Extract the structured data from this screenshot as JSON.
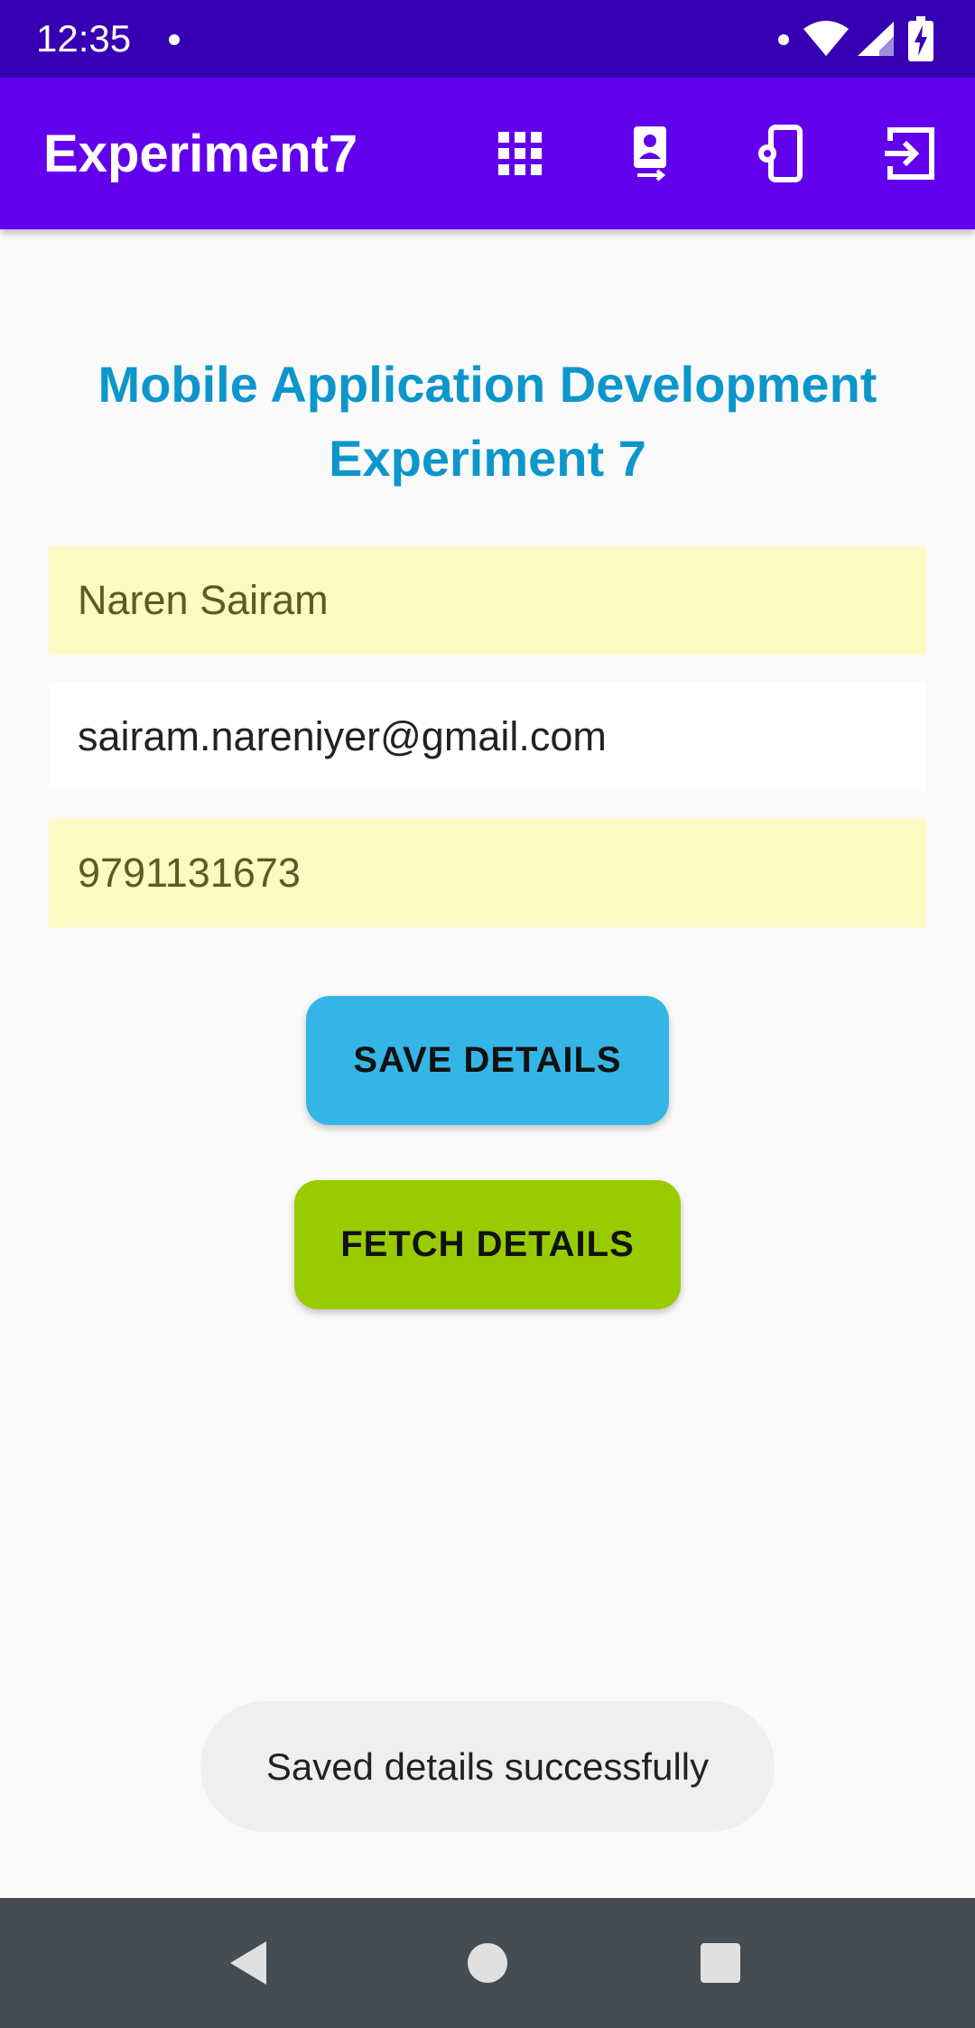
{
  "status_bar": {
    "time": "12:35",
    "icons": [
      "notification-dot-icon",
      "wifi-icon",
      "signal-icon",
      "battery-charging-icon"
    ]
  },
  "app_bar": {
    "title": "Experiment7",
    "actions": [
      {
        "name": "apps-grid-icon"
      },
      {
        "name": "portrait-transfer-icon"
      },
      {
        "name": "phone-settings-icon"
      },
      {
        "name": "exit-to-app-icon"
      }
    ]
  },
  "main": {
    "heading": "Mobile Application Development Experiment 7",
    "name_value": "Naren Sairam",
    "email_value": "sairam.nareniyer@gmail.com",
    "phone_value": "9791131673",
    "save_label": "SAVE DETAILS",
    "fetch_label": "FETCH DETAILS"
  },
  "toast": {
    "message": "Saved details successfully"
  },
  "nav_bar": {
    "buttons": [
      "back-icon",
      "home-icon",
      "recents-icon"
    ]
  },
  "colors": {
    "status_bar": "#3700b3",
    "app_bar": "#6200ee",
    "heading": "#0c96cc",
    "save_button": "#35b5e5",
    "fetch_button": "#99cc00",
    "field_yellow": "#fff9c4"
  }
}
